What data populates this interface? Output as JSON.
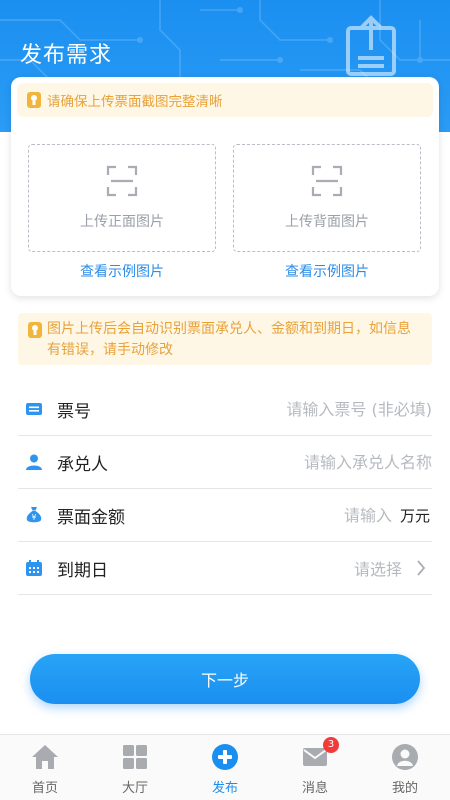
{
  "header": {
    "title": "发布需求"
  },
  "upload": {
    "tip": "请确保上传票面截图完整清晰",
    "front_label": "上传正面图片",
    "back_label": "上传背面图片",
    "front_sample": "查看示例图片",
    "back_sample": "查看示例图片"
  },
  "notice": {
    "text": "图片上传后会自动识别票面承兑人、金额和到期日，如信息有错误，请手动修改"
  },
  "form": {
    "ticket_no": {
      "label": "票号",
      "placeholder": "请输入票号 (非必填)",
      "value": ""
    },
    "acceptor": {
      "label": "承兑人",
      "placeholder": "请输入承兑人名称",
      "value": ""
    },
    "amount": {
      "label": "票面金额",
      "placeholder": "请输入",
      "value": "",
      "unit": "万元"
    },
    "due_date": {
      "label": "到期日",
      "placeholder": "请选择"
    }
  },
  "next_button": "下一步",
  "tabbar": {
    "items": [
      {
        "label": "首页",
        "icon": "home-icon"
      },
      {
        "label": "大厅",
        "icon": "grid-icon"
      },
      {
        "label": "发布",
        "icon": "plus-circle-icon",
        "active": true
      },
      {
        "label": "消息",
        "icon": "mail-icon",
        "badge": "3"
      },
      {
        "label": "我的",
        "icon": "user-icon"
      }
    ]
  },
  "colors": {
    "primary": "#1b8ff0",
    "tip": "#e8a23a",
    "tip_bg": "#fff7e6",
    "badge": "#f23a3a"
  }
}
